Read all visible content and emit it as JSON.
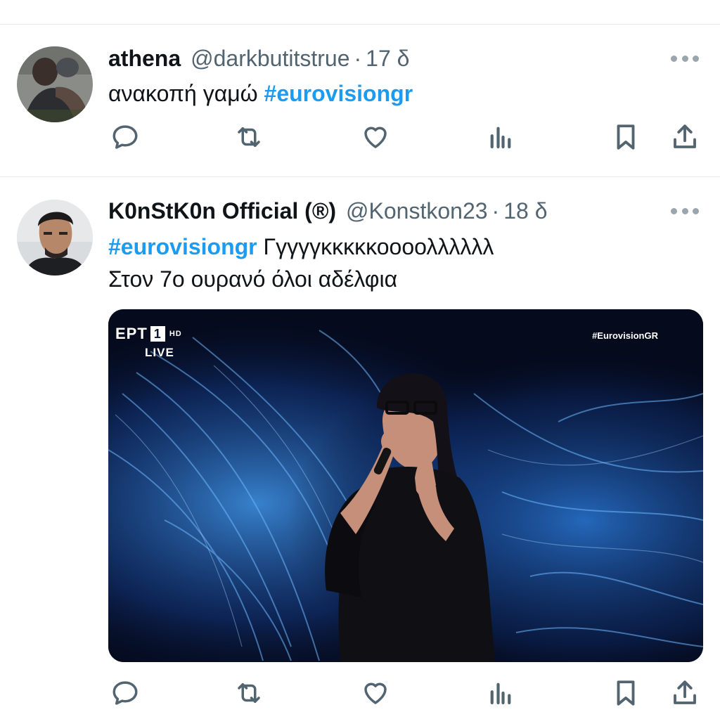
{
  "tweets": [
    {
      "name": "athena",
      "handle": "@darkbutitstrue",
      "separator": "·",
      "time": "17 δ",
      "text_plain": "ανακοπή γαμώ ",
      "hashtag": "#eurovisiongr",
      "actions": [
        "reply-icon",
        "retweet-icon",
        "like-icon",
        "views-icon",
        "bookmark-icon",
        "share-icon"
      ]
    },
    {
      "name": "K0nStK0n Official (®)",
      "handle": "@Konstkon23",
      "separator": "·",
      "time": "18 δ",
      "hashtag": "#eurovisiongr",
      "text_line1_rest": " Γγγγγκκκκκοοοολλλλλλ",
      "text_line2": "Στον 7ο ουρανό όλοι αδέλφια",
      "media": {
        "channel": "ΕΡΤ",
        "channel_number": "1",
        "quality": "HD",
        "live_label": "LIVE",
        "tag": "#EurovisionGR"
      },
      "actions": [
        "reply-icon",
        "retweet-icon",
        "like-icon",
        "views-icon",
        "bookmark-icon",
        "share-icon"
      ]
    }
  ],
  "colors": {
    "accent": "#1d9bf0",
    "text": "#0f1419",
    "secondary": "#536471",
    "icon": "#536471",
    "divider": "#e6e9eb"
  }
}
